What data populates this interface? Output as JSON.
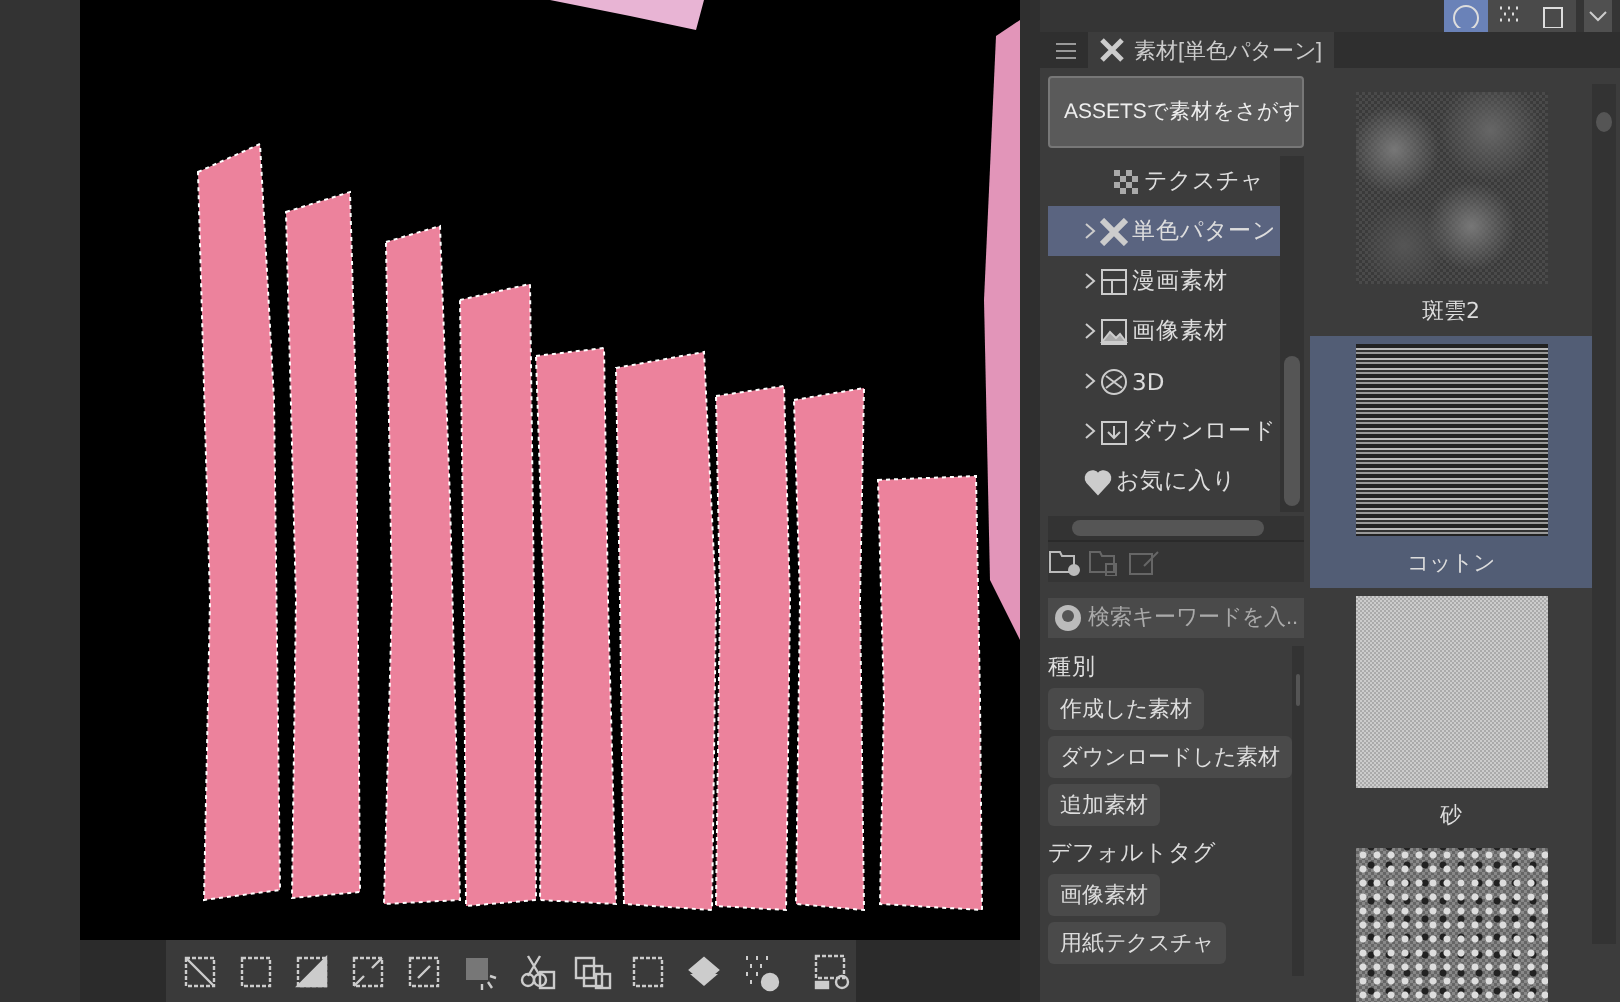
{
  "view_toggles": [
    {
      "kind": "circle",
      "selected": true
    },
    {
      "kind": "dots",
      "selected": false
    },
    {
      "kind": "square",
      "selected": false
    }
  ],
  "panel_tab": {
    "label": "素材[単色パターン]"
  },
  "assets_button": {
    "label": "ASSETSで素材をさがす"
  },
  "tree": [
    {
      "label": "テクスチャ",
      "kind": "texture",
      "expandable": false,
      "selected": false
    },
    {
      "label": "単色パターン",
      "kind": "pattern",
      "expandable": true,
      "selected": true
    },
    {
      "label": "漫画素材",
      "kind": "manga",
      "expandable": true,
      "selected": false
    },
    {
      "label": "画像素材",
      "kind": "image",
      "expandable": true,
      "selected": false
    },
    {
      "label": "3D",
      "kind": "cube",
      "expandable": true,
      "selected": false
    },
    {
      "label": "ダウンロード",
      "kind": "download",
      "expandable": true,
      "selected": false
    },
    {
      "label": "お気に入り",
      "kind": "favorite",
      "expandable": false,
      "selected": false
    }
  ],
  "search": {
    "placeholder": "検索キーワードを入..."
  },
  "tag_groups": [
    {
      "title": "種別",
      "tags": [
        "作成した素材",
        "ダウンロードした素材",
        "追加素材"
      ]
    },
    {
      "title": "デフォルトタグ",
      "tags": [
        "画像素材",
        "用紙テクスチャ"
      ]
    }
  ],
  "materials": [
    {
      "label": "斑雲2",
      "kind": "cloud",
      "selected": false
    },
    {
      "label": "コットン",
      "kind": "stripes",
      "selected": true
    },
    {
      "label": "砂",
      "kind": "noise",
      "selected": false
    },
    {
      "kind": "speckle",
      "selected": false
    }
  ]
}
